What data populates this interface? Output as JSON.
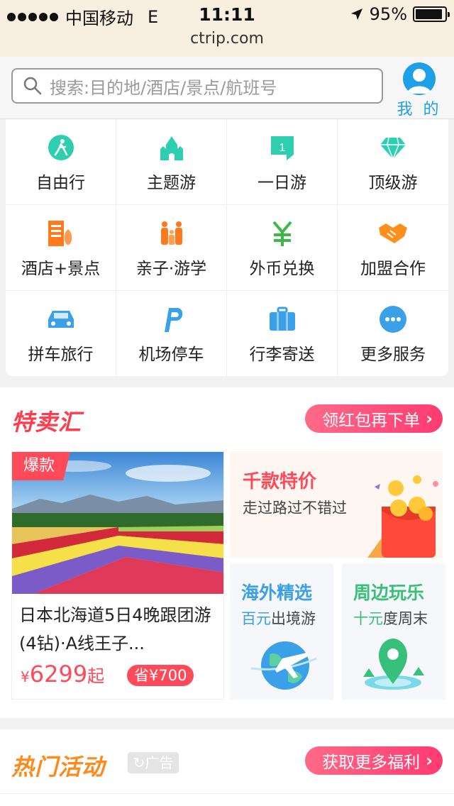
{
  "status_bar": {
    "carrier": "中国移动",
    "network": "E",
    "time": "11:11",
    "battery": "95%",
    "battery_level": 0.95,
    "url": "ctrip.com"
  },
  "header": {
    "search_placeholder": "搜索:目的地/酒店/景点/航班号",
    "me_label": "我 的",
    "accent_color": "#1ea0e6"
  },
  "grid": {
    "items": [
      {
        "label": "自由行",
        "icon": "free-travel-icon"
      },
      {
        "label": "主题游",
        "icon": "castle-icon"
      },
      {
        "label": "一日游",
        "icon": "one-day-flag-icon"
      },
      {
        "label": "顶级游",
        "icon": "diamond-icon"
      },
      {
        "label": "酒店+景点",
        "icon": "hotel-scenic-icon"
      },
      {
        "label": "亲子·游学",
        "icon": "family-icon"
      },
      {
        "label": "外币兑换",
        "icon": "currency-exchange-icon"
      },
      {
        "label": "加盟合作",
        "icon": "handshake-icon"
      },
      {
        "label": "拼车旅行",
        "icon": "car-icon"
      },
      {
        "label": "机场停车",
        "icon": "parking-icon"
      },
      {
        "label": "行李寄送",
        "icon": "luggage-icon"
      },
      {
        "label": "更多服务",
        "icon": "more-icon"
      }
    ]
  },
  "deals": {
    "title": "特卖汇",
    "red_packet_button": "领红包再下单",
    "featured": {
      "tag": "爆款",
      "title": "日本北海道5日4晚跟团游(4钻)·A线王子...",
      "price_symbol": "¥",
      "price": "6299",
      "price_suffix": "起",
      "save": "省¥700"
    },
    "promo": {
      "title": "千款特价",
      "subtitle": "走过路过不错过"
    },
    "overseas": {
      "title": "海外精选",
      "highlight": "百元",
      "rest": "出境游",
      "color": "#3aa0e8"
    },
    "nearby": {
      "title": "周边玩乐",
      "highlight": "十元",
      "rest": "度周末",
      "color": "#36c07a"
    }
  },
  "hot": {
    "title": "热门活动",
    "ad_label": "广告",
    "more_button": "获取更多福利"
  }
}
